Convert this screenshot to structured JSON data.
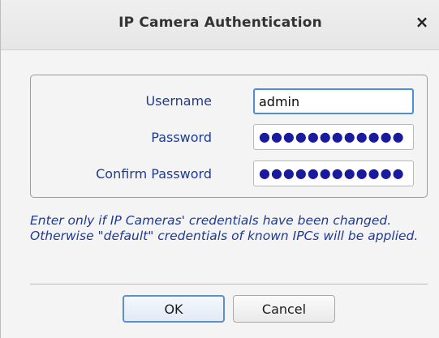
{
  "dialog": {
    "title": "IP Camera Authentication",
    "close_label": "×"
  },
  "form": {
    "username_label": "Username",
    "username_value": "admin",
    "password_label": "Password",
    "password_value": "●●●●●●●●●●●●",
    "confirm_label": "Confirm Password",
    "confirm_value": "●●●●●●●●●●●●"
  },
  "info_text": "Enter only if IP Cameras' credentials have been changed. Otherwise \"default\" credentials of known IPCs will be applied.",
  "buttons": {
    "ok_label": "OK",
    "cancel_label": "Cancel"
  },
  "colors": {
    "label_text": "#1f3a93",
    "focus_border": "#4a90d9",
    "password_dots": "#1a1a9e"
  }
}
